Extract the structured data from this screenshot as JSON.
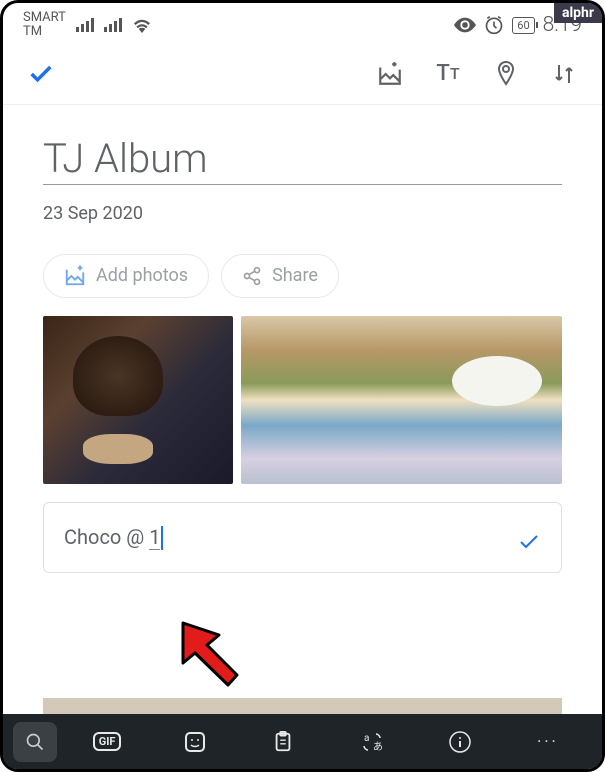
{
  "watermark": "alphr",
  "status_bar": {
    "carrier_line1": "SMART",
    "carrier_line2": "TM",
    "battery": "60",
    "time": "8:19"
  },
  "toolbar": {
    "confirm": "check",
    "add_image": "add-image",
    "text_format": "Tt",
    "location": "pin",
    "sort": "sort"
  },
  "album": {
    "title": "TJ Album",
    "date": "23 Sep 2020"
  },
  "actions": {
    "add_photos": "Add photos",
    "share": "Share"
  },
  "caption": {
    "text_prefix": "Choco @ ",
    "text_underlined": "1"
  },
  "keyboard": {
    "gif": "GIF",
    "more": "···"
  }
}
